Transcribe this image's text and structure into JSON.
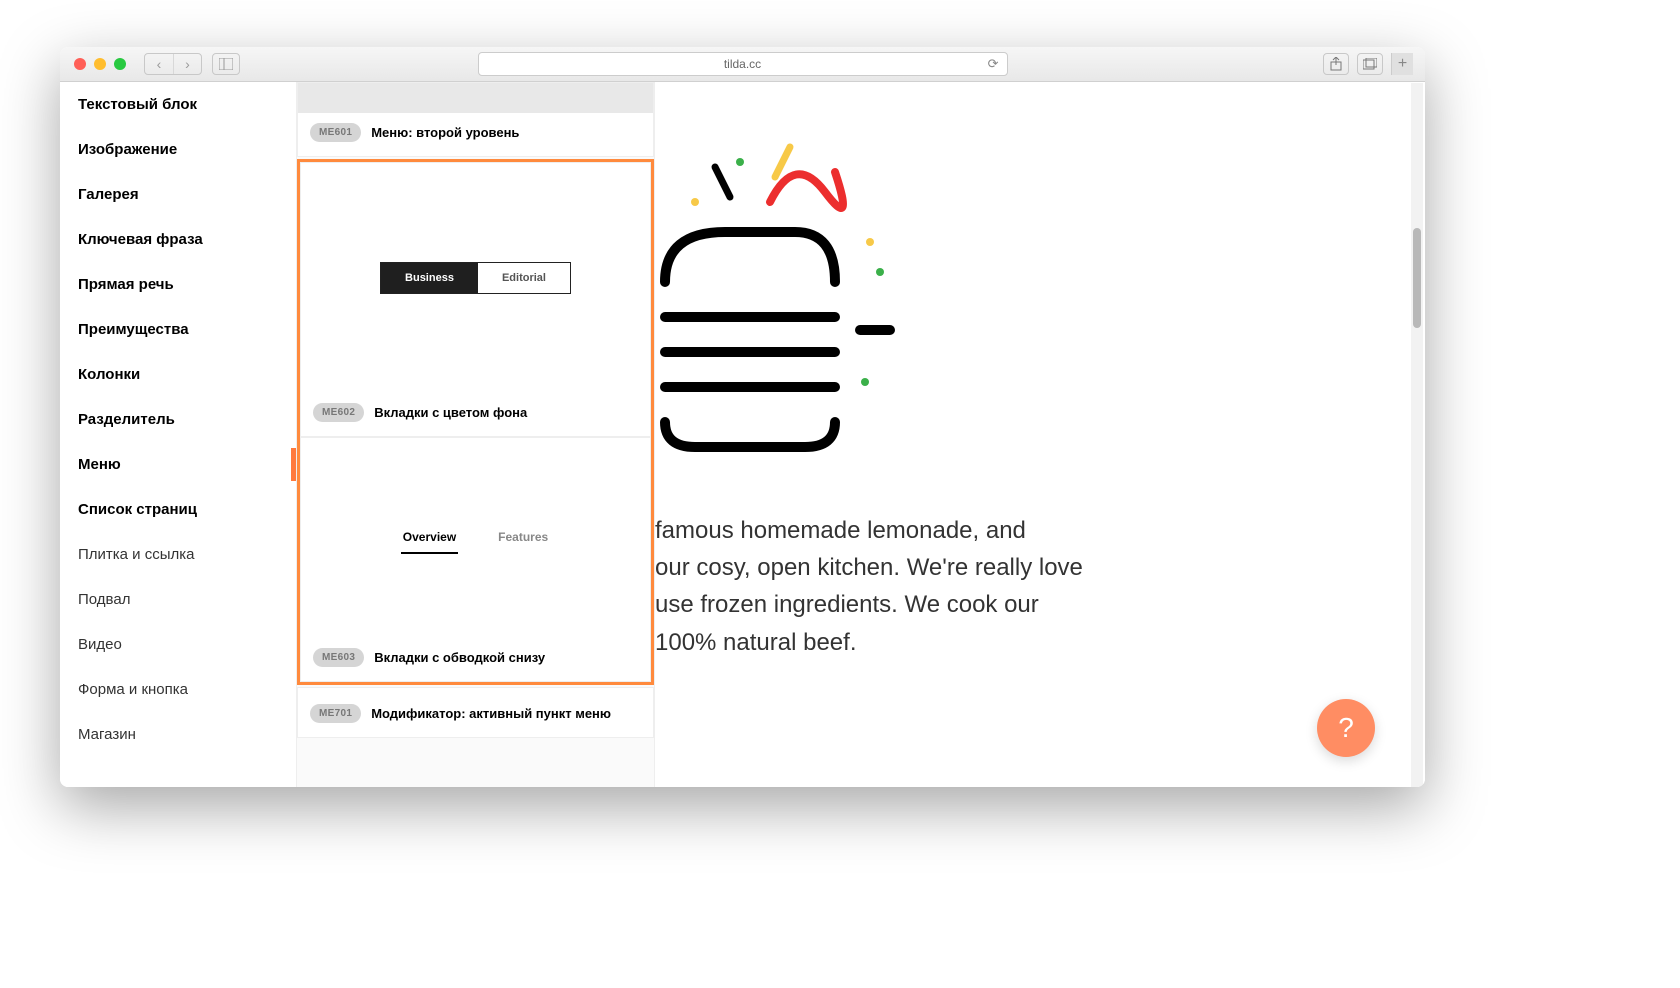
{
  "browser": {
    "url": "tilda.cc"
  },
  "sidebar": {
    "items": [
      {
        "label": "Текстовый блок",
        "weight": "bold"
      },
      {
        "label": "Изображение",
        "weight": "bold"
      },
      {
        "label": "Галерея",
        "weight": "bold"
      },
      {
        "label": "Ключевая фраза",
        "weight": "bold"
      },
      {
        "label": "Прямая речь",
        "weight": "bold"
      },
      {
        "label": "Преимущества",
        "weight": "bold"
      },
      {
        "label": "Колонки",
        "weight": "bold"
      },
      {
        "label": "Разделитель",
        "weight": "bold"
      },
      {
        "label": "Меню",
        "weight": "bold",
        "active": true
      },
      {
        "label": "Список страниц",
        "weight": "bold"
      },
      {
        "label": "Плитка и ссылка",
        "weight": "light"
      },
      {
        "label": "Подвал",
        "weight": "light"
      },
      {
        "label": "Видео",
        "weight": "light"
      },
      {
        "label": "Форма и кнопка",
        "weight": "light"
      },
      {
        "label": "Магазин",
        "weight": "light"
      }
    ]
  },
  "blocks": {
    "me601": {
      "code": "ME601",
      "title": "Меню: второй уровень"
    },
    "me602": {
      "code": "ME602",
      "title": "Вкладки с цветом фона",
      "tabs": {
        "active": "Business",
        "inactive": "Editorial"
      }
    },
    "me603": {
      "code": "ME603",
      "title": "Вкладки с обводкой снизу",
      "tabs": {
        "active": "Overview",
        "inactive": "Features"
      }
    },
    "me701": {
      "code": "ME701",
      "title": "Модификатор: активный пункт меню"
    }
  },
  "content": {
    "paragraph_fragment": " famous homemade lemonade, and\nour cosy, open kitchen. We're really love\nuse frozen ingredients. We cook our\n100% natural beef."
  },
  "help": {
    "label": "?"
  }
}
